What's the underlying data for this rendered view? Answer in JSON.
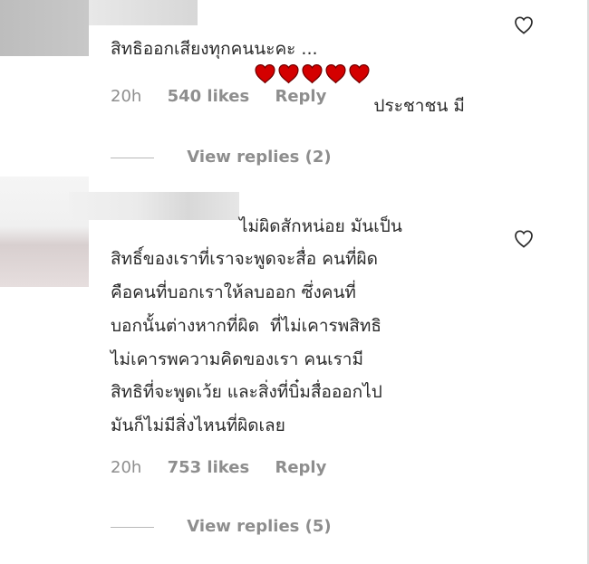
{
  "comments": [
    {
      "text": "ประชาชน มีสิทธิออกเสียงทุกคนนะคะ ...",
      "line1": "ประชาชน มี",
      "line2": "สิทธิออกเสียงทุกคนนะคะ ...",
      "time": "20h",
      "likes": "540 likes",
      "reply": "Reply",
      "view_replies": "View replies (2)"
    },
    {
      "text": "ไม่ผิดสักหน่อย มันเป็นสิทธิ์ของเราที่เราจะพูดจะสื่อ คนที่ผิดคือคนที่บอกเราให้ลบออก ซึ่งคนที่บอกนั้นต่างหากที่ผิด ที่ไม่เคารพสิทธิไม่เคารพความคิดของเรา คนเรามีสิทธิที่จะพูดเว้ย และสิ่งที่บิ๋มสื่อออกไปมันก็ไม่มีสิ่งไหนที่ผิดเลย",
      "lines": [
        "ไม่ผิดสักหน่อย มันเป็น",
        "สิทธิ์ของเราที่เราจะพูดจะสื่อ คนที่ผิด",
        "คือคนที่บอกเราให้ลบออก ซึ่งคนที่",
        "บอกนั้นต่างหากที่ผิด  ที่ไม่เคารพสิทธิ",
        "ไม่เคารพความคิดของเรา คนเรามี",
        "สิทธิที่จะพูดเว้ย และสิ่งที่บิ๋มสื่อออกไป",
        "มันก็ไม่มีสิ่งไหนที่ผิดเลย"
      ],
      "time": "20h",
      "likes": "753 likes",
      "reply": "Reply",
      "view_replies": "View replies (5)"
    }
  ],
  "icons": {
    "heart_outline": "heart-outline-icon",
    "heart_emoji": "red-heart-icon"
  },
  "colors": {
    "meta": "#8e8e8e",
    "text": "#262626",
    "heart": "#d00000"
  }
}
